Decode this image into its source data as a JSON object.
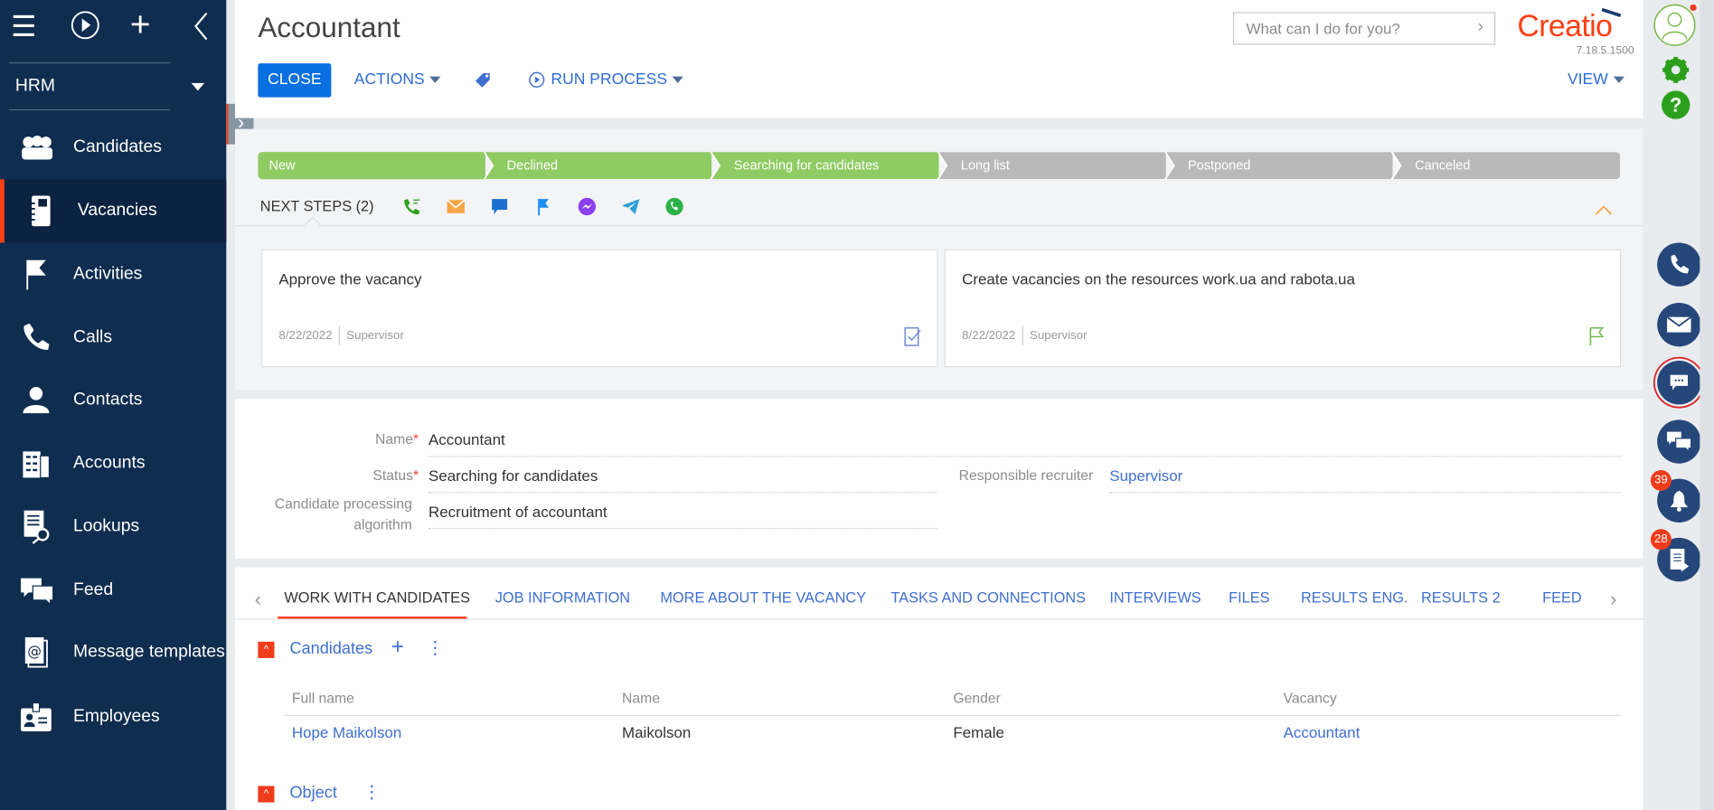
{
  "sidebar": {
    "workspace": "HRM",
    "items": [
      {
        "label": "Candidates",
        "icon": "candidates-icon"
      },
      {
        "label": "Vacancies",
        "icon": "vacancies-icon",
        "active": true
      },
      {
        "label": "Activities",
        "icon": "flag-icon"
      },
      {
        "label": "Calls",
        "icon": "phone-icon"
      },
      {
        "label": "Contacts",
        "icon": "contact-icon"
      },
      {
        "label": "Accounts",
        "icon": "building-icon"
      },
      {
        "label": "Lookups",
        "icon": "lookup-icon"
      },
      {
        "label": "Feed",
        "icon": "feed-icon"
      },
      {
        "label": "Message templates",
        "icon": "message-template-icon"
      },
      {
        "label": "Employees",
        "icon": "employee-badge-icon"
      }
    ]
  },
  "header": {
    "title": "Accountant",
    "close": "CLOSE",
    "actions": "ACTIONS",
    "run_process": "RUN PROCESS",
    "view": "VIEW",
    "search_placeholder": "What can I do for you?",
    "logo": "Creatio",
    "version": "7.18.5.1500"
  },
  "stages": [
    {
      "label": "New",
      "done": true
    },
    {
      "label": "Declined",
      "done": true
    },
    {
      "label": "Searching for candidates",
      "done": true
    },
    {
      "label": "Long list",
      "done": false
    },
    {
      "label": "Postponed",
      "done": false
    },
    {
      "label": "Canceled",
      "done": false
    }
  ],
  "next_steps": {
    "label": "NEXT STEPS (2)",
    "cards": [
      {
        "title": "Approve the vacancy",
        "date": "8/22/2022",
        "owner": "Supervisor"
      },
      {
        "title": "Create vacancies on the resources work.ua and rabota.ua",
        "date": "8/22/2022",
        "owner": "Supervisor"
      }
    ]
  },
  "fields": {
    "name_label": "Name",
    "name": "Accountant",
    "status_label": "Status",
    "status": "Searching for candidates",
    "algo_label": "Candidate processing algorithm",
    "algo": "Recruitment of accountant",
    "recruiter_label": "Responsible recruiter",
    "recruiter": "Supervisor"
  },
  "tabs": [
    "WORK WITH CANDIDATES",
    "JOB INFORMATION",
    "MORE ABOUT THE VACANCY",
    "TASKS AND CONNECTIONS",
    "INTERVIEWS",
    "FILES",
    "RESULTS ENG.",
    "RESULTS 2",
    "FEED"
  ],
  "candidates": {
    "title": "Candidates",
    "columns": [
      "Full name",
      "Name",
      "Gender",
      "Vacancy"
    ],
    "rows": [
      [
        "Hope Maikolson",
        "Maikolson",
        "Female",
        "Accountant"
      ]
    ]
  },
  "object": {
    "title": "Object"
  },
  "badges": {
    "notifications": "39",
    "processes": "28"
  },
  "colors": {
    "sidebar": "#0f2d4f",
    "accent": "#ff4013",
    "stage_done": "#8fcb63",
    "stage_todo": "#b9b9b9",
    "primary": "#0a6fe0"
  }
}
